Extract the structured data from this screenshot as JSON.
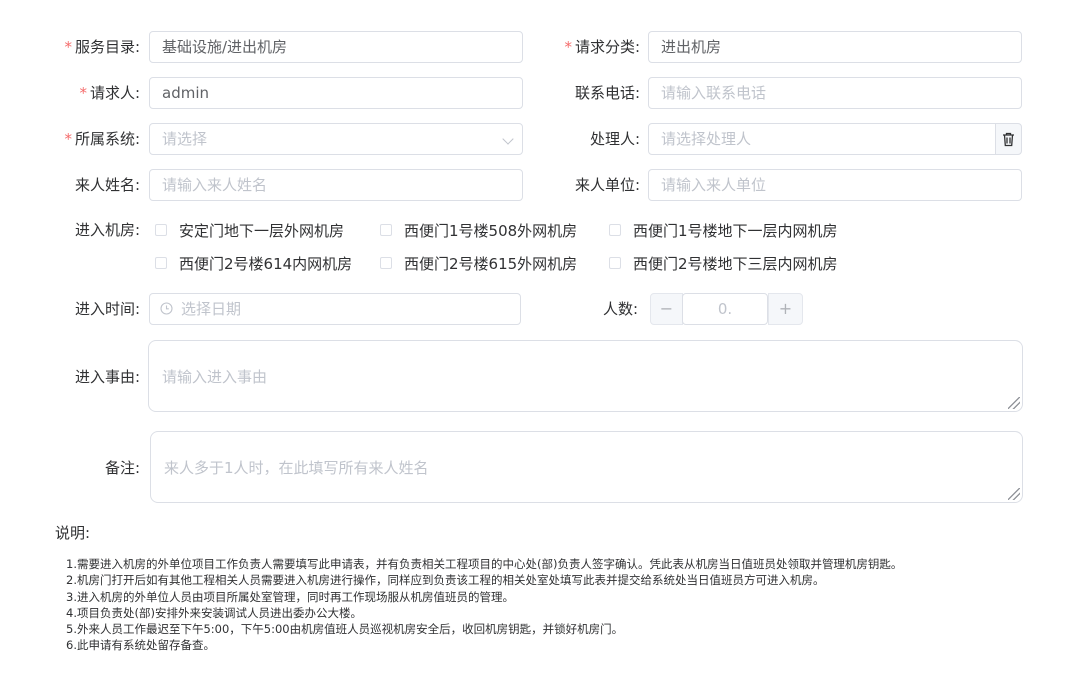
{
  "form": {
    "service_catalog": {
      "label": "服务目录:",
      "value": "基础设施/进出机房"
    },
    "request_category": {
      "label": "请求分类:",
      "value": "进出机房"
    },
    "requester": {
      "label": "请求人:",
      "value": "admin"
    },
    "contact_phone": {
      "label": "联系电话:",
      "placeholder": "请输入联系电话"
    },
    "system": {
      "label": "所属系统:",
      "placeholder": "请选择"
    },
    "handler": {
      "label": "处理人:",
      "placeholder": "请选择处理人"
    },
    "visitor_name": {
      "label": "来人姓名:",
      "placeholder": "请输入来人姓名"
    },
    "visitor_unit": {
      "label": "来人单位:",
      "placeholder": "请输入来人单位"
    },
    "rooms": {
      "label": "进入机房:",
      "options": [
        "安定门地下一层外网机房",
        "西便门1号楼508外网机房",
        "西便门1号楼地下一层内网机房",
        "西便门2号楼614内网机房",
        "西便门2号楼615外网机房",
        "西便门2号楼地下三层内网机房"
      ]
    },
    "entry_time": {
      "label": "进入时间:",
      "placeholder": "选择日期"
    },
    "headcount": {
      "label": "人数:",
      "value": "0.",
      "minus": "−",
      "plus": "+"
    },
    "reason": {
      "label": "进入事由:",
      "placeholder": "请输入进入事由"
    },
    "remarks": {
      "label": "备注:",
      "placeholder": "来人多于1人时，在此填写所有来人姓名"
    }
  },
  "required_mark": "*",
  "notes": {
    "title": "说明:",
    "items": [
      "1.需要进入机房的外单位项目工作负责人需要填写此申请表，并有负责相关工程项目的中心处(部)负责人签字确认。凭此表从机房当日值班员处领取并管理机房钥匙。",
      "2.机房门打开后如有其他工程相关人员需要进入机房进行操作，同样应到负责该工程的相关处室处填写此表并提交给系统处当日值班员方可进入机房。",
      "3.进入机房的外单位人员由项目所属处室管理，同时再工作现场服从机房值班员的管理。",
      "4.项目负责处(部)安排外来安装调试人员进出委办公大楼。",
      "5.外来人员工作最迟至下午5:00，下午5:00由机房值班人员巡视机房安全后，收回机房钥匙，并锁好机房门。",
      "6.此申请有系统处留存备查。"
    ]
  },
  "colors": {
    "required": "#f56c6c",
    "border": "#dcdfe6",
    "placeholder": "#c0c4cc"
  },
  "icons": {
    "handler_clear": "trash-icon",
    "date": "clock-icon",
    "select": "chevron-down-icon"
  }
}
